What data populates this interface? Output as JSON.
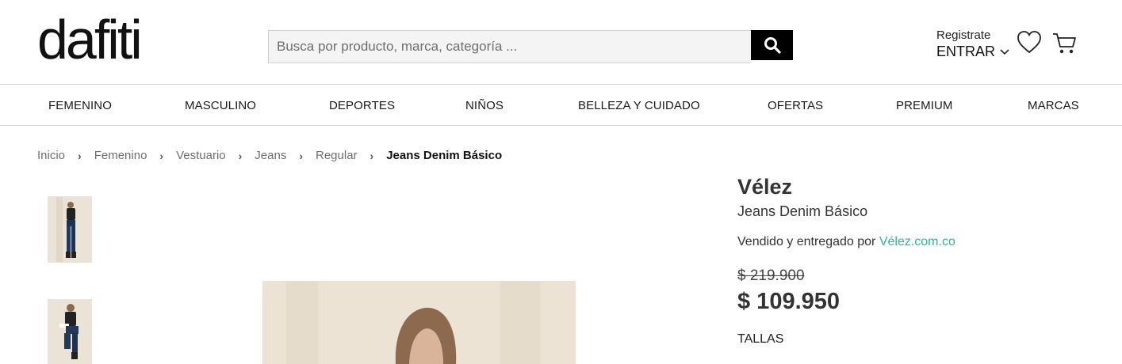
{
  "header": {
    "logo": "dafiti",
    "search_placeholder": "Busca por producto, marca, categoría ...",
    "register_label": "Registrate",
    "login_label": "ENTRAR"
  },
  "nav": {
    "items": [
      "FEMENINO",
      "MASCULINO",
      "DEPORTES",
      "NIÑOS",
      "BELLEZA Y CUIDADO",
      "OFERTAS",
      "PREMIUM",
      "MARCAS"
    ]
  },
  "breadcrumb": {
    "items": [
      "Inicio",
      "Femenino",
      "Vestuario",
      "Jeans",
      "Regular"
    ],
    "current": "Jeans Denim Básico"
  },
  "product": {
    "brand": "Vélez",
    "name": "Jeans Denim Básico",
    "seller_prefix": "Vendido y entregado por",
    "seller_link": "Vélez.com.co",
    "old_price": "$ 219.900",
    "price": "$ 109.950",
    "sizes_label": "TALLAS"
  },
  "colors": {
    "accent_link": "#2ab5a0",
    "search_button": "#000000"
  }
}
